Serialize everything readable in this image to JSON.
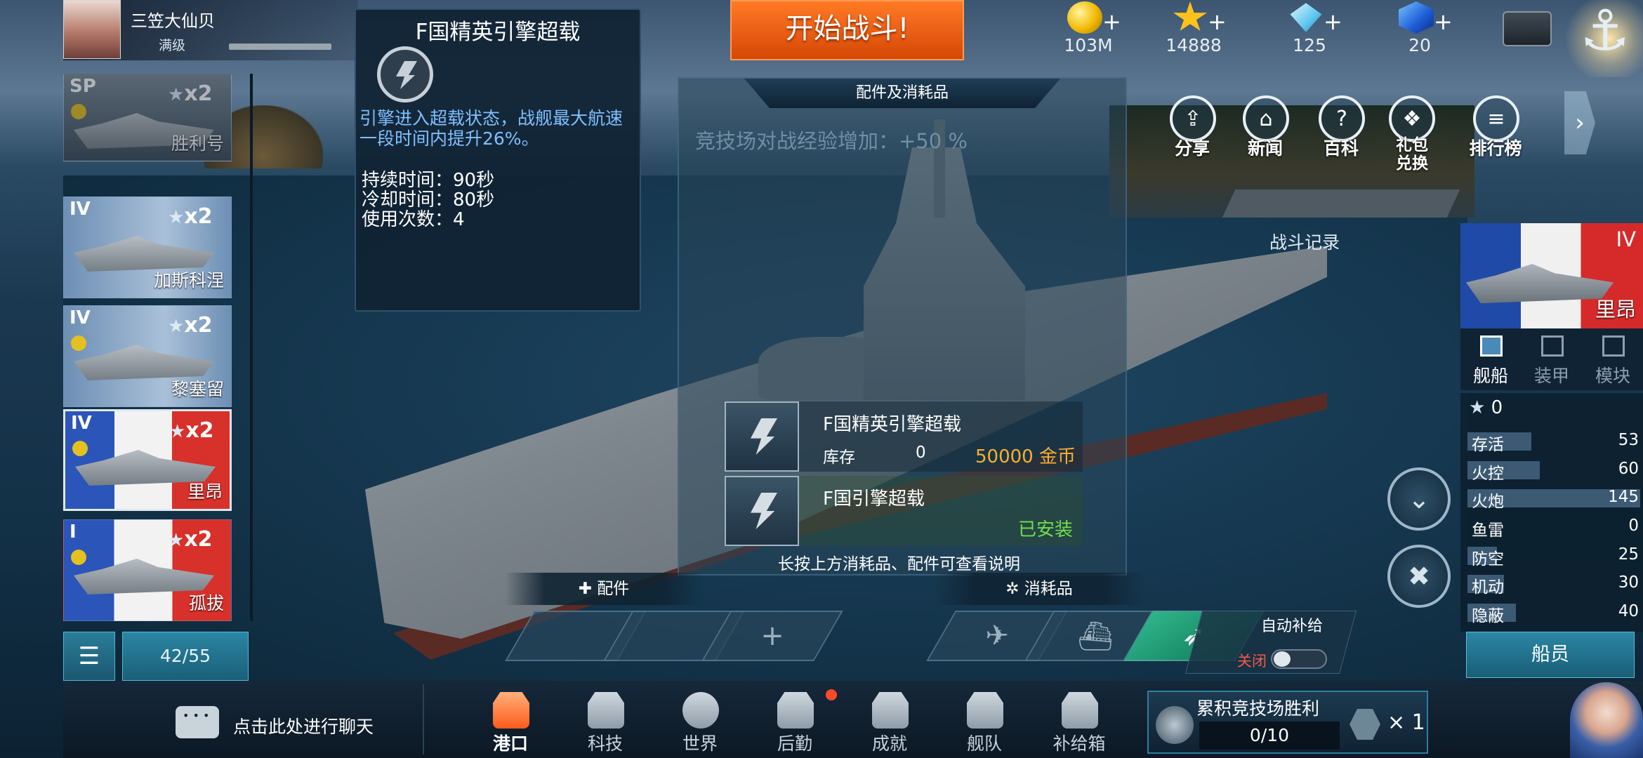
{
  "player": {
    "name": "三笠大仙贝",
    "level_label": "满级"
  },
  "start_button": "开始战斗!",
  "resources": [
    {
      "icon": "gold-coin-icon",
      "value": "103M"
    },
    {
      "icon": "star-icon",
      "value": "14888"
    },
    {
      "icon": "diamond-icon",
      "value": "125"
    },
    {
      "icon": "blue-cube-icon",
      "value": "20"
    }
  ],
  "plus_sign": "+",
  "tooltip": {
    "title": "F国精英引擎超载",
    "description": "引擎进入超载状态，战舰最大航速一段时间内提升26%。",
    "duration": "持续时间：90秒",
    "cooldown": "冷却时间：80秒",
    "uses": "使用次数：4"
  },
  "ship_list": [
    {
      "tier": "SP",
      "stars": "x2",
      "name": "胜利号",
      "dimmed": true
    },
    {
      "tier": "IV",
      "stars": "x2",
      "name": "加斯科涅"
    },
    {
      "tier": "IV",
      "stars": "x2",
      "name": "黎塞留"
    },
    {
      "tier": "IV",
      "stars": "x2",
      "name": "里昂",
      "active": true
    },
    {
      "tier": "I",
      "stars": "x2",
      "name": "孤拔"
    }
  ],
  "ship_count": "42/55",
  "panel": {
    "title": "配件及消耗品",
    "bonus": "竞技场对战经验增加：+50 %",
    "items": [
      {
        "name": "F国精英引擎超载",
        "stock_label": "库存",
        "stock": "0",
        "price": "50000 金币"
      },
      {
        "name": "F国引擎超载",
        "status": "已安装"
      }
    ],
    "hint": "长按上方消耗品、配件可查看说明"
  },
  "slots": {
    "parts_label": "配件",
    "consumables_label": "消耗品",
    "auto_supply": "自动补给",
    "off": "关闭"
  },
  "quick_icons": [
    {
      "label": "分享",
      "icon": "share-icon"
    },
    {
      "label": "新闻",
      "icon": "house-icon"
    },
    {
      "label": "百科",
      "icon": "question-icon"
    },
    {
      "label": "礼包兑换",
      "icon": "gift-icon"
    },
    {
      "label": "排行榜",
      "icon": "ranking-icon"
    }
  ],
  "battle_log": "战斗记录",
  "selected_ship": {
    "tier": "IV",
    "name": "里昂"
  },
  "right_tabs": [
    {
      "label": "舰船"
    },
    {
      "label": "装甲"
    },
    {
      "label": "模块"
    }
  ],
  "star_count": "0",
  "stats": [
    {
      "label": "存活",
      "value": "53",
      "fill": 0.37
    },
    {
      "label": "火控",
      "value": "60",
      "fill": 0.42
    },
    {
      "label": "火炮",
      "value": "145",
      "fill": 1.0
    },
    {
      "label": "鱼雷",
      "value": "0",
      "fill": 0.0
    },
    {
      "label": "防空",
      "value": "25",
      "fill": 0.17
    },
    {
      "label": "机动",
      "value": "30",
      "fill": 0.21
    },
    {
      "label": "隐蔽",
      "value": "40",
      "fill": 0.28
    }
  ],
  "crew_button": "船员",
  "chat": "点击此处进行聊天",
  "nav": [
    {
      "label": "港口"
    },
    {
      "label": "科技"
    },
    {
      "label": "世界"
    },
    {
      "label": "后勤"
    },
    {
      "label": "成就"
    },
    {
      "label": "舰队"
    },
    {
      "label": "补给箱"
    }
  ],
  "arena": {
    "label": "累积竞技场胜利",
    "progress": "0/10",
    "multiplier": "× 1"
  }
}
